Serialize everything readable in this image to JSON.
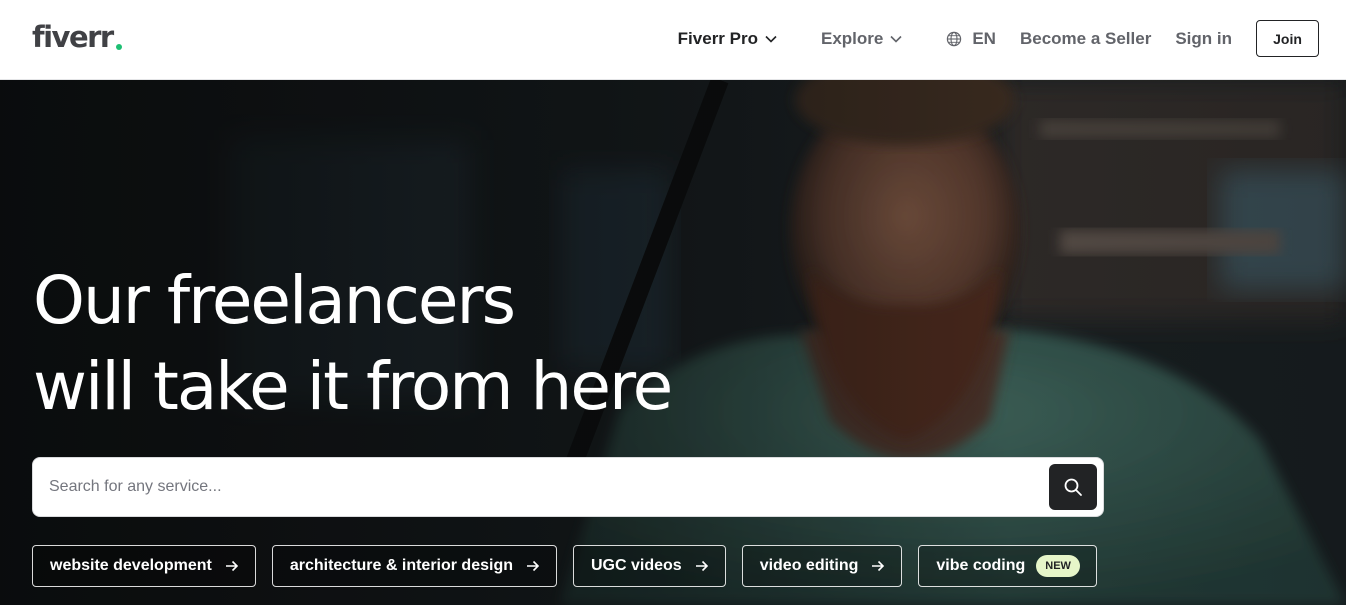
{
  "header": {
    "logo_text": "fiverr",
    "logo_dot_color": "#1dbf73",
    "nav": {
      "fiverr_pro": "Fiverr Pro",
      "explore": "Explore",
      "language": "EN",
      "become_seller": "Become a Seller",
      "sign_in": "Sign in",
      "join": "Join"
    }
  },
  "hero": {
    "headline_line1": "Our freelancers",
    "headline_line2": "will take it from here",
    "search": {
      "placeholder": "Search for any service...",
      "value": ""
    },
    "chips": [
      {
        "label": "website development",
        "icon": "arrow-right-icon"
      },
      {
        "label": "architecture & interior design",
        "icon": "arrow-right-icon"
      },
      {
        "label": "UGC videos",
        "icon": "arrow-right-icon"
      },
      {
        "label": "video editing",
        "icon": "arrow-right-icon"
      },
      {
        "label": "vibe coding",
        "badge": "NEW"
      }
    ]
  },
  "colors": {
    "brand_green": "#1dbf73",
    "text_dark": "#222325",
    "text_muted": "#62646a",
    "new_badge_bg": "#e6f6c9"
  },
  "icons": {
    "language": "globe-icon",
    "dropdown": "chevron-down-icon",
    "search": "search-icon"
  }
}
